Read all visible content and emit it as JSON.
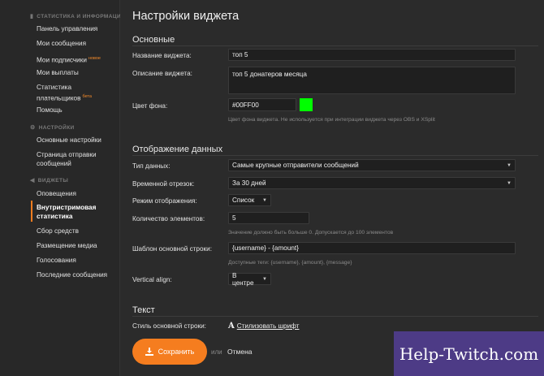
{
  "sidebar": {
    "sections": [
      {
        "title": "СТАТИСТИКА И ИНФОРМАЦИЯ",
        "icon": "bar-chart-icon"
      },
      {
        "title": "НАСТРОЙКИ",
        "icon": "gear-icon"
      },
      {
        "title": "ВИДЖЕТЫ",
        "icon": "megaphone-icon"
      }
    ],
    "items": [
      {
        "label": "Панель управления"
      },
      {
        "label": "Мои сообщения"
      },
      {
        "label": "Мои подписчики",
        "badge": "новое"
      },
      {
        "label": "Мои выплаты"
      },
      {
        "label": "Статистика плательщиков",
        "badge": "бета"
      },
      {
        "label": "Помощь"
      },
      {
        "label": "Основные настройки"
      },
      {
        "label": "Страница отправки сообщений"
      },
      {
        "label": "Оповещения"
      },
      {
        "label": "Внутристримовая статистика",
        "active": true
      },
      {
        "label": "Сбор средств"
      },
      {
        "label": "Размещение медиа"
      },
      {
        "label": "Голосования"
      },
      {
        "label": "Последние сообщения"
      }
    ]
  },
  "main": {
    "title": "Настройки виджета",
    "basic": {
      "title": "Основные",
      "name_label": "Название виджета:",
      "name_value": "топ 5",
      "desc_label": "Описание виджета:",
      "desc_value": "топ 5 донатеров месяца",
      "bg_label": "Цвет фона:",
      "bg_value": "#00FF00",
      "bg_color": "#00ff00",
      "bg_hint": "Цвет фона виджета. Не используется при интеграции виджета через OBS и XSplit"
    },
    "display": {
      "title": "Отображение данных",
      "type_label": "Тип данных:",
      "type_value": "Самые крупные отправители сообщений",
      "period_label": "Временной отрезок:",
      "period_value": "За 30 дней",
      "mode_label": "Режим отображения:",
      "mode_value": "Список",
      "count_label": "Количество элементов:",
      "count_value": "5",
      "count_hint": "Значение должно быть больше 0. Допускается до 100 элементов",
      "template_label": "Шаблон основной строки:",
      "template_value": "{username} - {amount}",
      "template_hint": "Доступные теги: {username}, {amount}, {message}",
      "valign_label": "Vertical align:",
      "valign_value": "В центре"
    },
    "text": {
      "title": "Текст",
      "style_label": "Стиль основной строки:",
      "style_button": "Стилизовать шрифт",
      "style_icon": "font-a-icon"
    },
    "actions": {
      "save": "Сохранить",
      "or": "или",
      "cancel": "Отмена"
    }
  },
  "watermark": "Help-Twitch.com",
  "colors": {
    "accent": "#f57d1f",
    "background": "#2b2b2b",
    "input_bg": "#1f1f1f"
  }
}
